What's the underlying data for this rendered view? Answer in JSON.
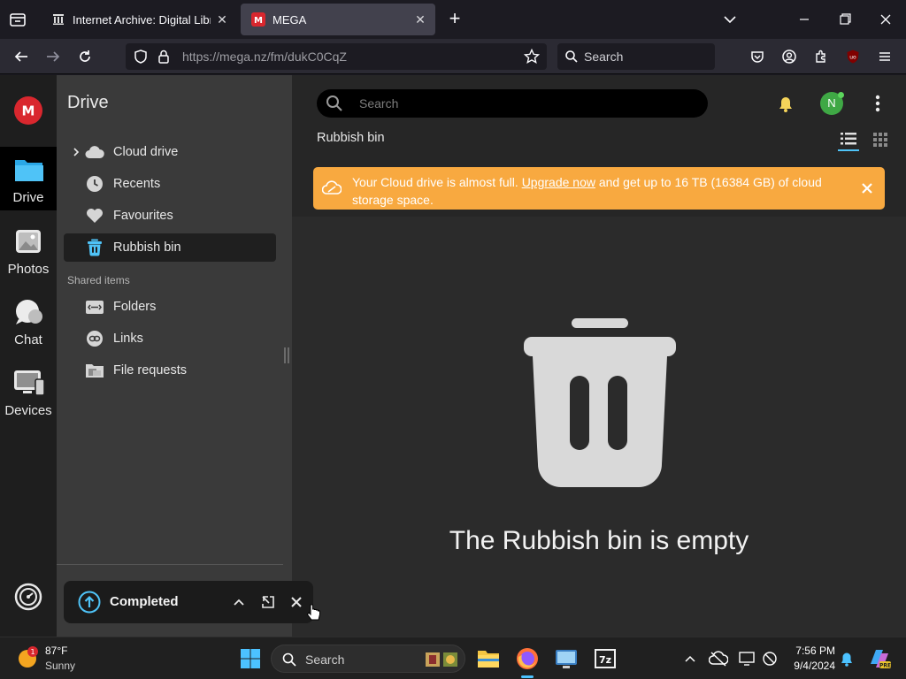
{
  "browser": {
    "tabs": [
      {
        "title": "Internet Archive: Digital Library"
      },
      {
        "title": "MEGA"
      }
    ],
    "url": "https://mega.nz/fm/dukC0CqZ",
    "search_placeholder": "Search"
  },
  "app": {
    "brand_color": "#d9272e",
    "rail": [
      {
        "label": "Drive"
      },
      {
        "label": "Photos"
      },
      {
        "label": "Chat"
      },
      {
        "label": "Devices"
      }
    ],
    "sidebar": {
      "title": "Drive",
      "items": [
        {
          "label": "Cloud drive"
        },
        {
          "label": "Recents"
        },
        {
          "label": "Favourites"
        },
        {
          "label": "Rubbish bin"
        }
      ],
      "shared_label": "Shared items",
      "shared_items": [
        {
          "label": "Folders"
        },
        {
          "label": "Links"
        },
        {
          "label": "File requests"
        }
      ]
    },
    "header": {
      "search_placeholder": "Search",
      "avatar_initial": "N"
    },
    "breadcrumb": "Rubbish bin",
    "banner": {
      "text_before": "Your Cloud drive is almost full.",
      "link": "Upgrade now",
      "text_after": "and get up to 16 TB (16384 GB) of cloud storage space.",
      "color": "#f8a940"
    },
    "empty_message": "The Rubbish bin is empty",
    "toast": {
      "title": "Completed"
    }
  },
  "taskbar": {
    "weather": {
      "temp": "87°F",
      "condition": "Sunny",
      "badge": "1"
    },
    "search_placeholder": "Search",
    "clock": {
      "time": "7:56 PM",
      "date": "9/4/2024"
    }
  }
}
